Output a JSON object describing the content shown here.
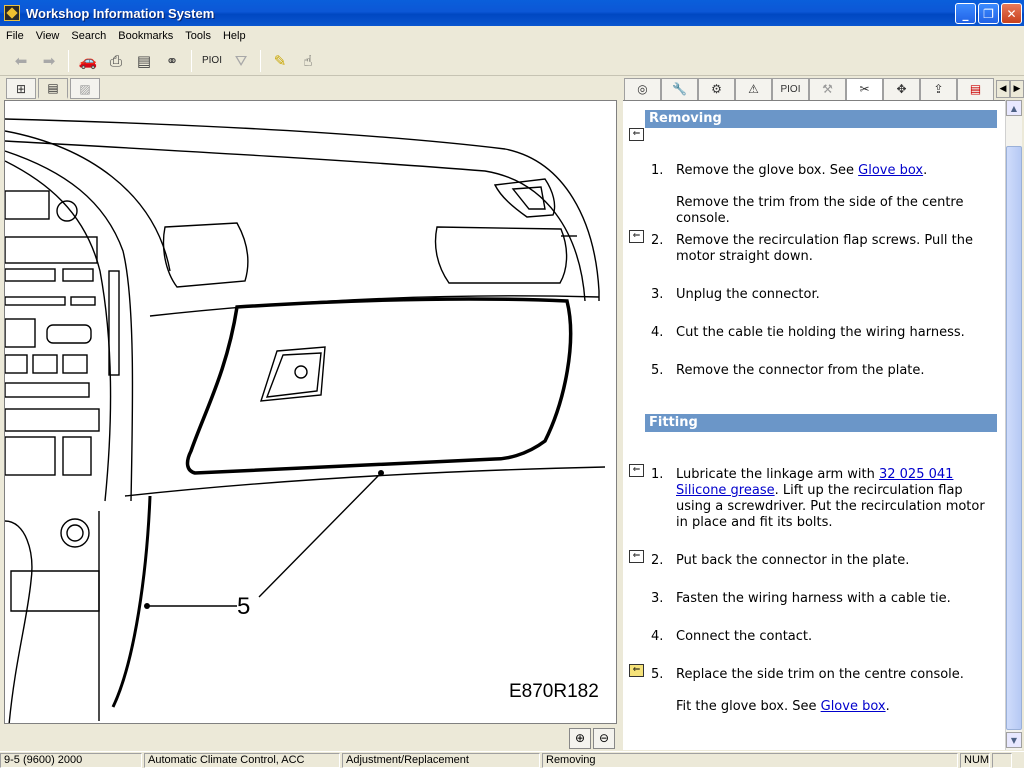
{
  "window": {
    "title": "Workshop Information System"
  },
  "menu": [
    "File",
    "View",
    "Search",
    "Bookmarks",
    "Tools",
    "Help"
  ],
  "toolbar": {
    "pioi_label": "PIOI"
  },
  "right_tabs": {
    "pioi_label": "PIOI"
  },
  "diagram": {
    "callout": "5",
    "figure_id": "E870R182"
  },
  "content": {
    "removing_title": "Removing",
    "removing_steps": [
      {
        "num": "1.",
        "pre": "Remove the glove box. See ",
        "link": "Glove box",
        "post": ".",
        "extra": "Remove the trim from the side of the centre console."
      },
      {
        "num": "2.",
        "text": "Remove the recirculation flap screws. Pull the motor straight down."
      },
      {
        "num": "3.",
        "text": "Unplug the connector."
      },
      {
        "num": "4.",
        "text": "Cut the cable tie holding the wiring harness."
      },
      {
        "num": "5.",
        "text": "Remove the connector from the plate."
      }
    ],
    "fitting_title": "Fitting",
    "fitting_steps": [
      {
        "num": "1.",
        "pre": "Lubricate the linkage arm with ",
        "link": "32 025 041 Silicone grease",
        "post": ". Lift up the recirculation flap using a screwdriver. Put the recirculation motor in place and fit its bolts."
      },
      {
        "num": "2.",
        "text": "Put back the connector in the plate."
      },
      {
        "num": "3.",
        "text": "Fasten the wiring harness with a cable tie."
      },
      {
        "num": "4.",
        "text": "Connect the contact."
      },
      {
        "num": "5.",
        "text": "Replace the side trim on the centre console.",
        "extra_pre": "Fit the glove box. See ",
        "extra_link": "Glove box",
        "extra_post": "."
      }
    ]
  },
  "status": {
    "model": "9-5 (9600) 2000",
    "system": "Automatic Climate Control, ACC",
    "category": "Adjustment/Replacement",
    "section": "Removing",
    "num": "NUM"
  }
}
